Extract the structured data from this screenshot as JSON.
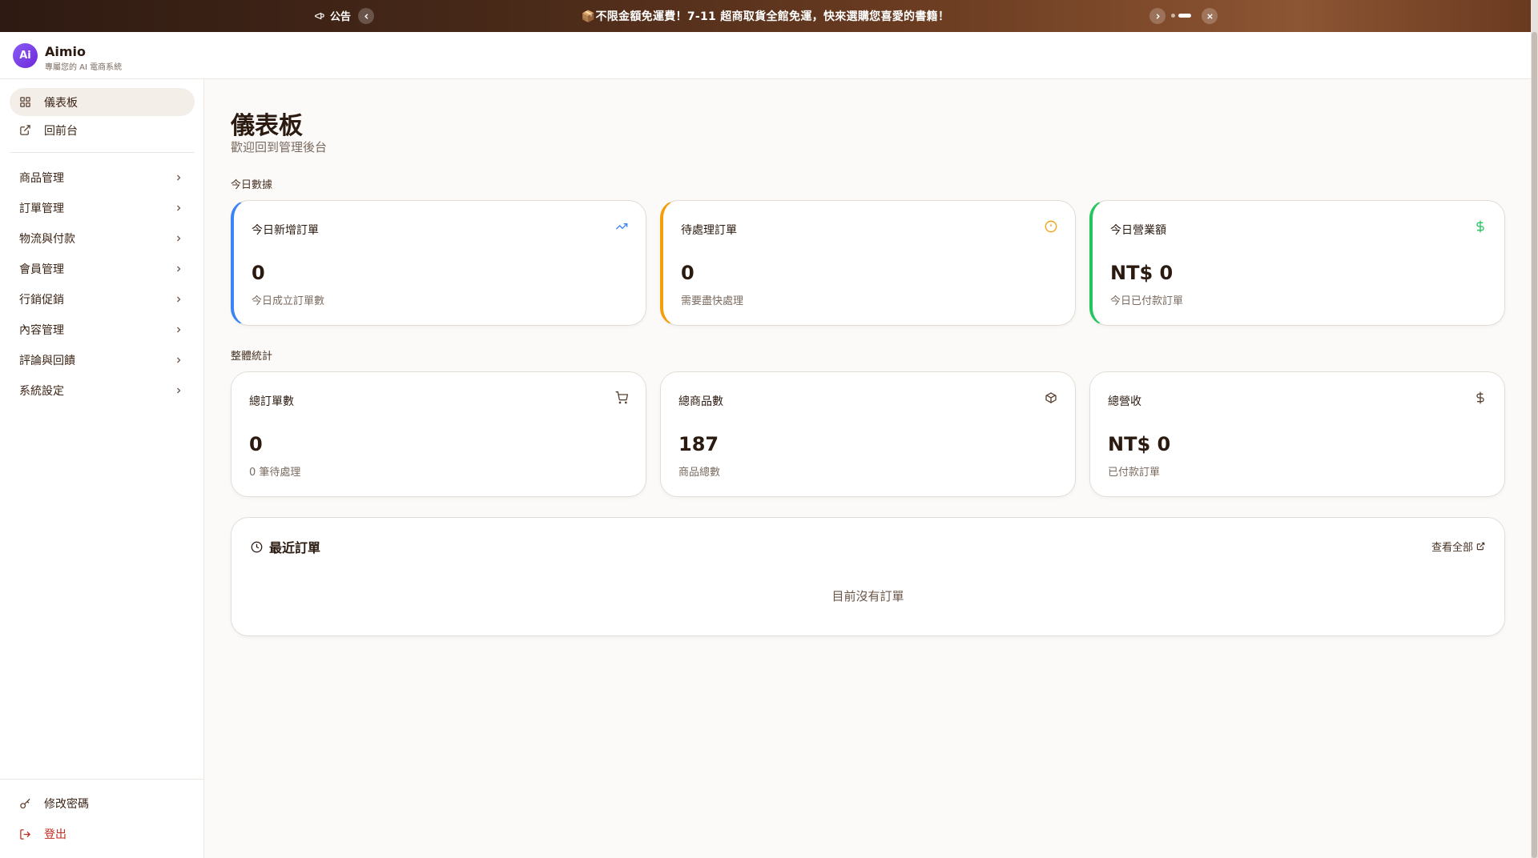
{
  "announcement": {
    "label": "公告",
    "message": "📦不限金額免運費！7-11 超商取貨全館免運，快來選購您喜愛的書籍！"
  },
  "brand": {
    "logo_text": "Ai",
    "name": "Aimio",
    "tagline": "專屬您的 AI 電商系統"
  },
  "sidebar": {
    "top_items": [
      {
        "label": "儀表板",
        "icon": "dashboard-icon"
      },
      {
        "label": "回前台",
        "icon": "external-link-icon"
      }
    ],
    "groups": [
      {
        "label": "商品管理"
      },
      {
        "label": "訂單管理"
      },
      {
        "label": "物流與付款"
      },
      {
        "label": "會員管理"
      },
      {
        "label": "行銷促銷"
      },
      {
        "label": "內容管理"
      },
      {
        "label": "評論與回饋"
      },
      {
        "label": "系統設定"
      }
    ],
    "bottom_items": [
      {
        "label": "修改密碼",
        "icon": "key-icon"
      },
      {
        "label": "登出",
        "icon": "logout-icon"
      }
    ]
  },
  "main": {
    "title": "儀表板",
    "subtitle": "歡迎回到管理後台",
    "today_section": "今日數據",
    "overall_section": "整體統計",
    "today_cards": [
      {
        "title": "今日新增訂單",
        "value": "0",
        "note": "今日成立訂單數",
        "color": "#3b82f6",
        "icon": "trending-up-icon"
      },
      {
        "title": "待處理訂單",
        "value": "0",
        "note": "需要盡快處理",
        "color": "#f59e0b",
        "icon": "alert-circle-icon"
      },
      {
        "title": "今日營業額",
        "value": "NT$ 0",
        "note": "今日已付款訂單",
        "color": "#22c55e",
        "icon": "dollar-icon"
      }
    ],
    "overall_cards": [
      {
        "title": "總訂單數",
        "value": "0",
        "note": "0 筆待處理",
        "icon": "cart-icon"
      },
      {
        "title": "總商品數",
        "value": "187",
        "note": "商品總數",
        "icon": "package-icon"
      },
      {
        "title": "總營收",
        "value": "NT$ 0",
        "note": "已付款訂單",
        "icon": "dollar-icon"
      }
    ],
    "recent": {
      "title": "最近訂單",
      "view_all": "查看全部",
      "empty": "目前沒有訂單"
    }
  },
  "colors": {
    "accent_blue": "#3b82f6",
    "accent_orange": "#f59e0b",
    "accent_green": "#22c55e",
    "logout_red": "#c2281c"
  }
}
